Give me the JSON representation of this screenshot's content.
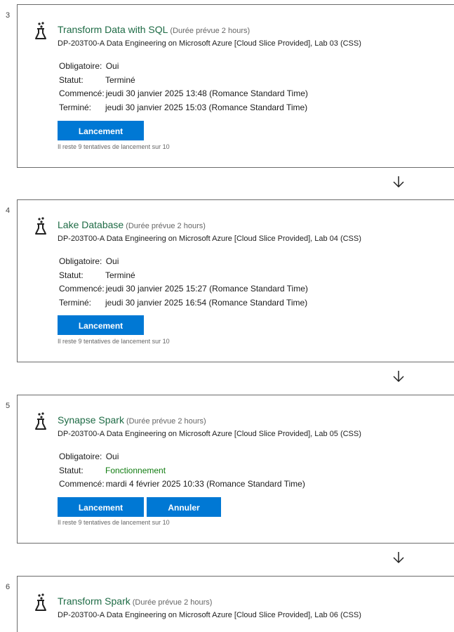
{
  "steps": [
    {
      "number": "3",
      "title": "Transform Data with SQL",
      "duration": "(Durée prévue 2 hours)",
      "course": "DP-203T00-A Data Engineering on Microsoft Azure [Cloud Slice Provided], Lab 03 (CSS)",
      "required_label": "Obligatoire:",
      "required_value": "Oui",
      "status_label": "Statut:",
      "status_value": "Terminé",
      "started_label": "Commencé:",
      "started_value": "jeudi 30 janvier 2025 13:48 (Romance Standard Time)",
      "ended_label": "Terminé:",
      "ended_value": "jeudi 30 janvier 2025 15:03 (Romance Standard Time)",
      "launch_label": "Lancement",
      "attempts_note": "Il reste 9 tentatives de lancement sur 10"
    },
    {
      "number": "4",
      "title": "Lake Database",
      "duration": "(Durée prévue 2 hours)",
      "course": "DP-203T00-A Data Engineering on Microsoft Azure [Cloud Slice Provided], Lab 04 (CSS)",
      "required_label": "Obligatoire:",
      "required_value": "Oui",
      "status_label": "Statut:",
      "status_value": "Terminé",
      "started_label": "Commencé:",
      "started_value": "jeudi 30 janvier 2025 15:27 (Romance Standard Time)",
      "ended_label": "Terminé:",
      "ended_value": "jeudi 30 janvier 2025 16:54 (Romance Standard Time)",
      "launch_label": "Lancement",
      "attempts_note": "Il reste 9 tentatives de lancement sur 10"
    },
    {
      "number": "5",
      "title": "Synapse Spark",
      "duration": "(Durée prévue 2 hours)",
      "course": "DP-203T00-A Data Engineering on Microsoft Azure [Cloud Slice Provided], Lab 05 (CSS)",
      "required_label": "Obligatoire:",
      "required_value": "Oui",
      "status_label": "Statut:",
      "status_value": "Fonctionnement",
      "started_label": "Commencé:",
      "started_value": "mardi 4 février 2025 10:33 (Romance Standard Time)",
      "launch_label": "Lancement",
      "cancel_label": "Annuler",
      "attempts_note": "Il reste 9 tentatives de lancement sur 10"
    },
    {
      "number": "6",
      "title": "Transform Spark",
      "duration": "(Durée prévue 2 hours)",
      "course": "DP-203T00-A Data Engineering on Microsoft Azure [Cloud Slice Provided], Lab 06 (CSS)"
    }
  ],
  "colors": {
    "title": "#1e6b45",
    "button": "#0078d4",
    "running_status": "#107c10",
    "border": "#6b6b6b"
  },
  "icons": {
    "lab": "flask-icon",
    "connector": "arrow-down-icon"
  }
}
